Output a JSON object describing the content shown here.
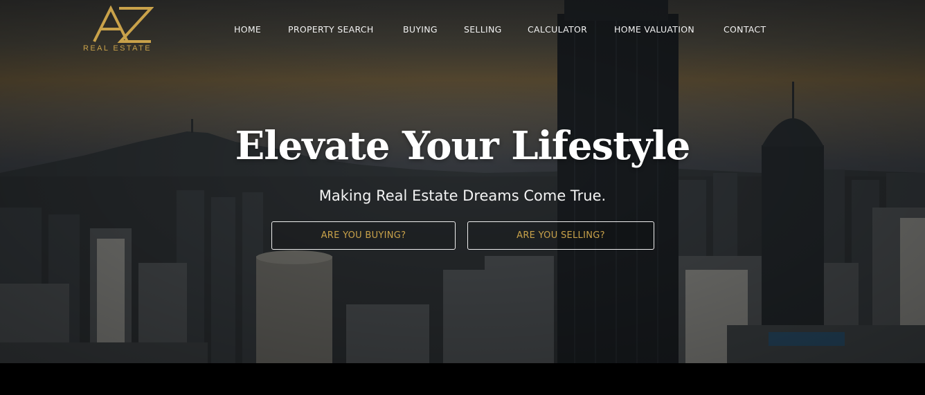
{
  "brand": {
    "monogram": "AZ",
    "name": "REAL ESTATE",
    "accent_color": "#c9a24a"
  },
  "nav": {
    "items": [
      {
        "label": "HOME"
      },
      {
        "label": "PROPERTY SEARCH"
      },
      {
        "label": "BUYING"
      },
      {
        "label": "SELLING"
      },
      {
        "label": "CALCULATOR"
      },
      {
        "label": "HOME VALUATION"
      },
      {
        "label": "CONTACT"
      }
    ]
  },
  "hero": {
    "headline": "Elevate Your Lifestyle",
    "subheadline": "Making Real Estate Dreams Come True.",
    "buttons": {
      "buying": "ARE YOU BUYING?",
      "selling": "ARE YOU SELLING?"
    },
    "background": "city-skyline-photo"
  }
}
